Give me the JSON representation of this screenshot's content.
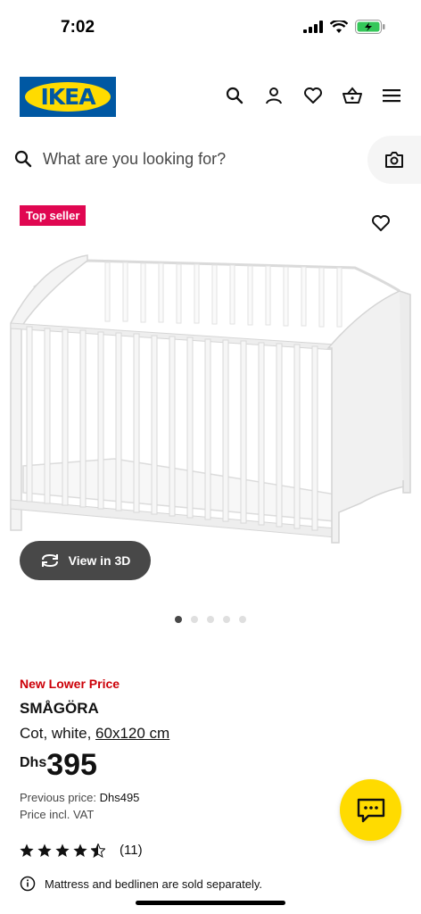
{
  "status": {
    "time": "7:02"
  },
  "header": {
    "logo_text": "IKEA",
    "icons": [
      "search-icon",
      "user-icon",
      "heart-icon",
      "basket-icon",
      "menu-icon"
    ]
  },
  "search": {
    "placeholder": "What are you looking for?"
  },
  "product_image": {
    "badge": "Top seller",
    "view3d_label": "View in 3D",
    "dots_total": 5,
    "dots_active": 0
  },
  "product": {
    "promo": "New Lower Price",
    "name": "SMÅGÖRA",
    "desc_prefix": "Cot, white, ",
    "desc_measure": "60x120 cm",
    "currency": "Dhs",
    "price": "395",
    "previous_label": "Previous price: ",
    "previous_value": "Dhs495",
    "vat": "Price incl. VAT",
    "rating": 4.5,
    "rating_count": "(11)",
    "notice": "Mattress and bedlinen are sold separately."
  },
  "colors": {
    "ikea_blue": "#0058a3",
    "ikea_yellow": "#ffdb00",
    "promo_red": "#cc0008",
    "badge_pink": "#e00751"
  }
}
